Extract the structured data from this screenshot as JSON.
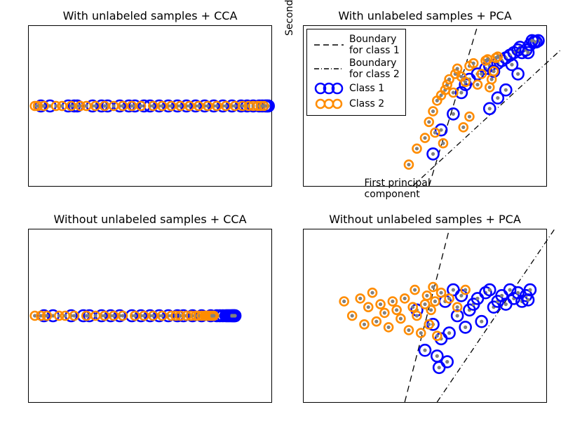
{
  "chart_data": [
    {
      "id": "tl",
      "type": "scatter",
      "title": "With unlabeled samples + CCA",
      "xlim": [
        -4,
        4
      ],
      "ylim": [
        -2,
        2
      ],
      "note": "All points lie on y≈0",
      "series": [
        {
          "name": "Class 1",
          "color": "#0000ff",
          "x": [
            -3.6,
            -3.3,
            -2.7,
            -2.5,
            -2.4,
            -1.9,
            -1.6,
            -1.4,
            -1.0,
            -0.7,
            -0.5,
            -0.2,
            0.0,
            0.3,
            0.6,
            0.9,
            1.2,
            1.5,
            1.8,
            2.1,
            2.4,
            2.7,
            3.0,
            3.2,
            3.4,
            3.6,
            3.7,
            3.8,
            3.85,
            3.9
          ],
          "y": [
            0,
            0,
            0,
            0,
            0,
            0,
            0,
            0,
            0,
            0,
            0,
            0,
            0,
            0,
            0,
            0,
            0,
            0,
            0,
            0,
            0,
            0,
            0,
            0,
            0,
            0,
            0,
            0,
            0,
            0
          ]
        },
        {
          "name": "Class 2",
          "color": "#ff8c00",
          "x": [
            -3.8,
            -3.7,
            -3.5,
            -3.1,
            -2.9,
            -2.6,
            -2.3,
            -2.1,
            -1.8,
            -1.5,
            -1.2,
            -0.9,
            -0.6,
            -0.3,
            0.1,
            0.4,
            0.7,
            1.0,
            1.3,
            1.6,
            1.9,
            2.2,
            2.5,
            2.8,
            3.05,
            3.25,
            3.4,
            3.55,
            3.65,
            3.75
          ],
          "y": [
            0,
            0,
            0,
            0,
            0,
            0,
            0,
            0,
            0,
            0,
            0,
            0,
            0,
            0,
            0,
            0,
            0,
            0,
            0,
            0,
            0,
            0,
            0,
            0,
            0,
            0,
            0,
            0,
            0,
            0
          ]
        }
      ]
    },
    {
      "id": "tr",
      "type": "scatter",
      "title": "With unlabeled samples + PCA",
      "xlabel": "First principal component",
      "ylabel": "Second principal component",
      "xlim": [
        -3,
        3
      ],
      "ylim": [
        -3,
        3
      ],
      "boundaries": [
        {
          "name": "Boundary for class 1",
          "style": "dashed",
          "x1": 0.1,
          "y1": -3.0,
          "x2": 1.3,
          "y2": 3.0
        },
        {
          "name": "Boundary for class 2",
          "style": "dashdot",
          "x1": -0.3,
          "y1": -3.0,
          "x2": 4.0,
          "y2": 3.0
        }
      ],
      "series": [
        {
          "name": "Class 1",
          "color": "#0000ff",
          "x": [
            0.2,
            0.4,
            0.7,
            0.9,
            1.0,
            1.1,
            1.3,
            1.5,
            1.6,
            1.7,
            1.8,
            1.9,
            2.0,
            2.1,
            2.2,
            2.3,
            2.35,
            2.4,
            2.5,
            2.6,
            2.7,
            2.75,
            2.8,
            2.3,
            2.0,
            1.8,
            1.6,
            2.15,
            2.55,
            2.65
          ],
          "y": [
            -1.8,
            -0.9,
            -0.3,
            0.5,
            0.8,
            1.0,
            1.2,
            1.4,
            1.5,
            1.3,
            1.6,
            1.7,
            1.8,
            1.9,
            2.0,
            2.1,
            2.2,
            2.0,
            2.1,
            2.3,
            2.4,
            2.4,
            2.45,
            1.2,
            0.6,
            0.3,
            -0.1,
            1.55,
            2.0,
            2.45
          ]
        },
        {
          "name": "Class 2",
          "color": "#ff8c00",
          "x": [
            -0.4,
            -0.2,
            0.0,
            0.1,
            0.2,
            0.3,
            0.4,
            0.5,
            0.55,
            0.6,
            0.7,
            0.75,
            0.8,
            0.9,
            1.0,
            1.1,
            1.2,
            1.3,
            1.4,
            1.5,
            1.55,
            1.6,
            1.65,
            1.7,
            1.75,
            1.8,
            1.1,
            0.95,
            0.25,
            0.45
          ],
          "y": [
            -2.2,
            -1.6,
            -1.2,
            -0.6,
            -0.2,
            0.2,
            0.4,
            0.6,
            0.8,
            1.0,
            0.5,
            1.2,
            1.4,
            1.1,
            0.9,
            1.5,
            1.6,
            0.8,
            1.2,
            1.7,
            1.75,
            0.7,
            1.0,
            1.3,
            1.8,
            1.85,
            -0.4,
            -0.8,
            -1.0,
            -1.4
          ]
        }
      ],
      "legend_position": "upper left"
    },
    {
      "id": "bl",
      "type": "scatter",
      "title": "Without unlabeled samples + CCA",
      "xlim": [
        -4,
        4
      ],
      "ylim": [
        -2,
        2
      ],
      "note": "All points lie on y≈0",
      "series": [
        {
          "name": "Class 1",
          "color": "#0000ff",
          "x": [
            -3.5,
            -3.2,
            -2.6,
            -2.2,
            -2.0,
            -1.6,
            -1.3,
            -1.0,
            -0.6,
            -0.3,
            0.0,
            0.3,
            0.6,
            0.9,
            1.1,
            1.4,
            1.7,
            2.0,
            2.2,
            2.3,
            2.4,
            2.5,
            2.55,
            2.6,
            2.65,
            2.7,
            2.72,
            2.75,
            2.78,
            2.8
          ],
          "y": [
            0,
            0,
            0,
            0,
            0,
            0,
            0,
            0,
            0,
            0,
            0,
            0,
            0,
            0,
            0,
            0,
            0,
            0,
            0,
            0,
            0,
            0,
            0,
            0,
            0,
            0,
            0,
            0,
            0,
            0
          ]
        },
        {
          "name": "Class 2",
          "color": "#ff8c00",
          "x": [
            -3.8,
            -3.6,
            -3.4,
            -3.0,
            -2.8,
            -2.5,
            -2.1,
            -1.8,
            -1.5,
            -1.2,
            -0.9,
            -0.5,
            -0.2,
            0.1,
            0.4,
            0.7,
            0.85,
            1.0,
            1.2,
            1.35,
            1.5,
            1.6,
            1.7,
            1.8,
            1.85,
            1.9,
            1.95,
            2.0,
            2.05,
            2.1
          ],
          "y": [
            0,
            0,
            0,
            0,
            0,
            0,
            0,
            0,
            0,
            0,
            0,
            0,
            0,
            0,
            0,
            0,
            0,
            0,
            0,
            0,
            0,
            0,
            0,
            0,
            0,
            0,
            0,
            0,
            0,
            0
          ]
        }
      ]
    },
    {
      "id": "br",
      "type": "scatter",
      "title": "Without unlabeled samples + PCA",
      "xlim": [
        -3,
        3
      ],
      "ylim": [
        -3,
        3
      ],
      "boundaries": [
        {
          "name": "Boundary for class 1",
          "style": "dashed",
          "x1": -0.5,
          "y1": -3.0,
          "x2": 0.6,
          "y2": 3.0
        },
        {
          "name": "Boundary for class 2",
          "style": "dashdot",
          "x1": 0.3,
          "y1": -3.0,
          "x2": 3.2,
          "y2": 3.0
        }
      ],
      "series": [
        {
          "name": "Class 1",
          "color": "#0000ff",
          "x": [
            -0.2,
            0.0,
            0.2,
            0.4,
            0.5,
            0.6,
            0.7,
            0.8,
            0.9,
            1.0,
            1.1,
            1.2,
            1.3,
            1.4,
            1.5,
            1.6,
            1.7,
            1.8,
            1.9,
            2.0,
            2.1,
            2.2,
            2.3,
            2.4,
            2.5,
            2.55,
            2.6,
            0.3,
            0.55,
            0.35
          ],
          "y": [
            0.2,
            -1.2,
            -0.3,
            -0.8,
            0.5,
            -0.6,
            0.9,
            0.0,
            0.7,
            -0.4,
            0.2,
            0.4,
            0.6,
            -0.2,
            0.8,
            0.9,
            0.3,
            0.5,
            0.7,
            0.4,
            0.9,
            0.6,
            0.8,
            0.5,
            0.7,
            0.55,
            0.9,
            -1.4,
            -1.6,
            -1.8
          ]
        },
        {
          "name": "Class 2",
          "color": "#ff8c00",
          "x": [
            -2.0,
            -1.8,
            -1.6,
            -1.5,
            -1.4,
            -1.3,
            -1.2,
            -1.1,
            -1.0,
            -0.9,
            -0.8,
            -0.7,
            -0.6,
            -0.5,
            -0.4,
            -0.3,
            -0.25,
            -0.2,
            -0.1,
            0.0,
            0.05,
            0.1,
            0.15,
            0.2,
            0.25,
            0.3,
            0.4,
            0.6,
            0.8,
            1.0
          ],
          "y": [
            0.5,
            0.0,
            0.6,
            -0.3,
            0.3,
            0.8,
            -0.2,
            0.4,
            0.1,
            -0.4,
            0.5,
            0.2,
            -0.1,
            0.6,
            -0.5,
            0.3,
            0.9,
            0.0,
            -0.6,
            0.4,
            0.7,
            -0.3,
            0.2,
            1.0,
            0.5,
            -0.7,
            0.8,
            0.6,
            0.3,
            0.9
          ]
        }
      ]
    }
  ],
  "legend": {
    "b1": "Boundary\nfor class 1",
    "b2": "Boundary\nfor class 2",
    "c1": "Class 1",
    "c2": "Class 2"
  },
  "xlabel_tr": "First principal component",
  "ylabel_tr": "Second principal component",
  "titles": {
    "tl": "With unlabeled samples + CCA",
    "tr": "With unlabeled samples + PCA",
    "bl": "Without unlabeled samples + CCA",
    "br": "Without unlabeled samples + PCA"
  }
}
